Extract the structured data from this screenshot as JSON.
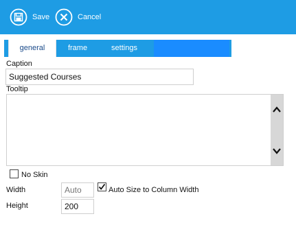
{
  "toolbar": {
    "save_label": "Save",
    "cancel_label": "Cancel",
    "accent": "#1e9ce4"
  },
  "tabs": {
    "general": "general",
    "frame": "frame",
    "settings": "settings"
  },
  "form": {
    "caption_label": "Caption",
    "caption_value": "Suggested Courses",
    "tooltip_label": "Tooltip",
    "tooltip_value": "",
    "no_skin_label": "No Skin",
    "no_skin_checked": false,
    "width_label": "Width",
    "width_placeholder": "Auto",
    "width_value": "",
    "auto_size_label": "Auto Size to Column Width",
    "auto_size_checked": true,
    "height_label": "Height",
    "height_value": "200"
  }
}
